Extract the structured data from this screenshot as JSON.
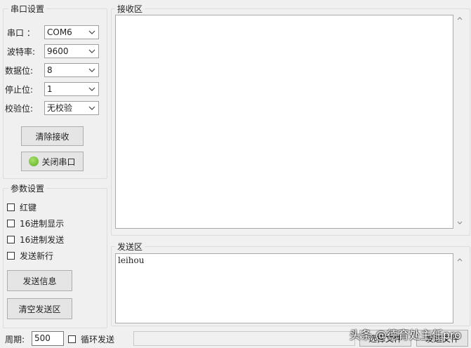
{
  "serial_group": {
    "title": "串口设置",
    "port_label": "串口 ：",
    "port_value": "COM6",
    "baud_label": "波特率:",
    "baud_value": "9600",
    "databits_label": "数据位:",
    "databits_value": "8",
    "stopbits_label": "停止位:",
    "stopbits_value": "1",
    "parity_label": "校验位:",
    "parity_value": "无校验",
    "clear_recv_label": "清除接收",
    "close_port_label": "关闭串口"
  },
  "param_group": {
    "title": "参数设置",
    "checkboxes": [
      {
        "label": "红键"
      },
      {
        "label": "16进制显示"
      },
      {
        "label": "16进制发送"
      },
      {
        "label": "发送新行"
      }
    ],
    "send_info_label": "发送信息",
    "clear_send_label": "清空发送区"
  },
  "receive_area": {
    "title": "接收区",
    "content": ""
  },
  "send_area": {
    "title": "发送区",
    "content": "leihou"
  },
  "bottom_bar": {
    "period_label": "周期:",
    "period_value": "500",
    "loop_send_label": "循环发送",
    "select_file_label": "选择文件",
    "send_file_label": "发送文件"
  },
  "watermark": "头条 @德育处主任pro",
  "colors": {
    "background": "#f0f0f0",
    "led_on": "#6fbf2e"
  }
}
